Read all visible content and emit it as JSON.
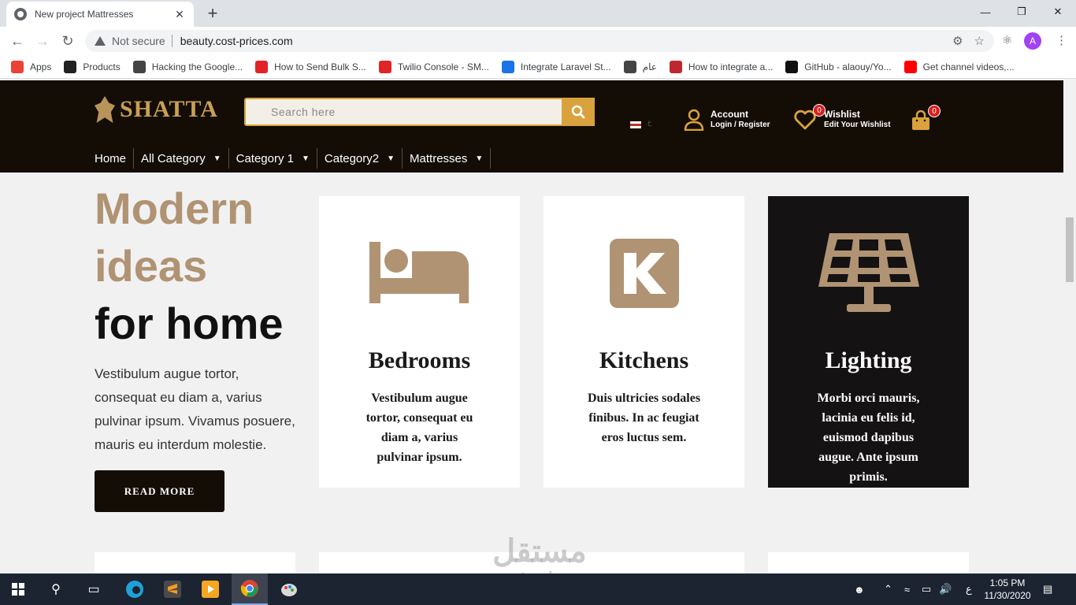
{
  "browser": {
    "tab_title": "New project Mattresses",
    "tab_close": "✕",
    "new_tab": "+",
    "not_secure": "Not secure",
    "url": "beauty.cost-prices.com",
    "avatar_letter": "A",
    "bookmarks": [
      {
        "label": "Apps",
        "color": "#ea4335"
      },
      {
        "label": "Products",
        "color": "#222222"
      },
      {
        "label": "Hacking the Google...",
        "color": "#444444"
      },
      {
        "label": "How to Send Bulk S...",
        "color": "#e22426"
      },
      {
        "label": "Twilio Console - SM...",
        "color": "#e22426"
      },
      {
        "label": "Integrate Laravel St...",
        "color": "#1a73e8"
      },
      {
        "label": "عام",
        "color": "#444444"
      },
      {
        "label": "How to integrate a...",
        "color": "#c0262d"
      },
      {
        "label": "GitHub - alaouy/Yo...",
        "color": "#111111"
      },
      {
        "label": "Get channel videos,...",
        "color": "#ff0000"
      }
    ]
  },
  "site": {
    "logo": "SHATTA",
    "search_placeholder": "Search here",
    "lang_label": "ع",
    "account_title": "Account",
    "account_sub": "Login / Register",
    "wishlist_title": "Wishlist",
    "wishlist_sub": "Edit Your Wishlist",
    "wishlist_count": "0",
    "cart_count": "0",
    "nav": [
      {
        "label": "Home",
        "dropdown": false
      },
      {
        "label": "All Category",
        "dropdown": true
      },
      {
        "label": "Category 1",
        "dropdown": true
      },
      {
        "label": "Category2",
        "dropdown": true
      },
      {
        "label": "Mattresses",
        "dropdown": true
      }
    ],
    "hero": {
      "line1": "Modern",
      "line2": "ideas",
      "line3": "for home",
      "text": "Vestibulum augue tortor, consequat eu diam a, varius pulvinar ipsum. Vivamus posuere, mauris eu interdum molestie.",
      "button": "READ MORE"
    },
    "cards": [
      {
        "icon": "bed-icon",
        "title": "Bedrooms",
        "desc": "Vestibulum augue tortor, consequat eu diam a, varius pulvinar ipsum."
      },
      {
        "icon": "kitchen-k-icon",
        "title": "Kitchens",
        "desc": "Duis ultricies sodales finibus. In ac feugiat eros luctus sem."
      },
      {
        "icon": "solar-panel-icon",
        "title": "Lighting",
        "desc": "Morbi orci mauris, lacinia eu felis id, euismod dapibus augue. Ante ipsum primis."
      }
    ],
    "colors": {
      "accent": "#d9a23c",
      "tan": "#b09373",
      "header_bg": "#140d06"
    }
  },
  "watermark": {
    "arabic": "مستقل",
    "latin": "mostaql.com"
  },
  "taskbar": {
    "time": "1:05 PM",
    "date": "11/30/2020",
    "lang": "ع"
  }
}
